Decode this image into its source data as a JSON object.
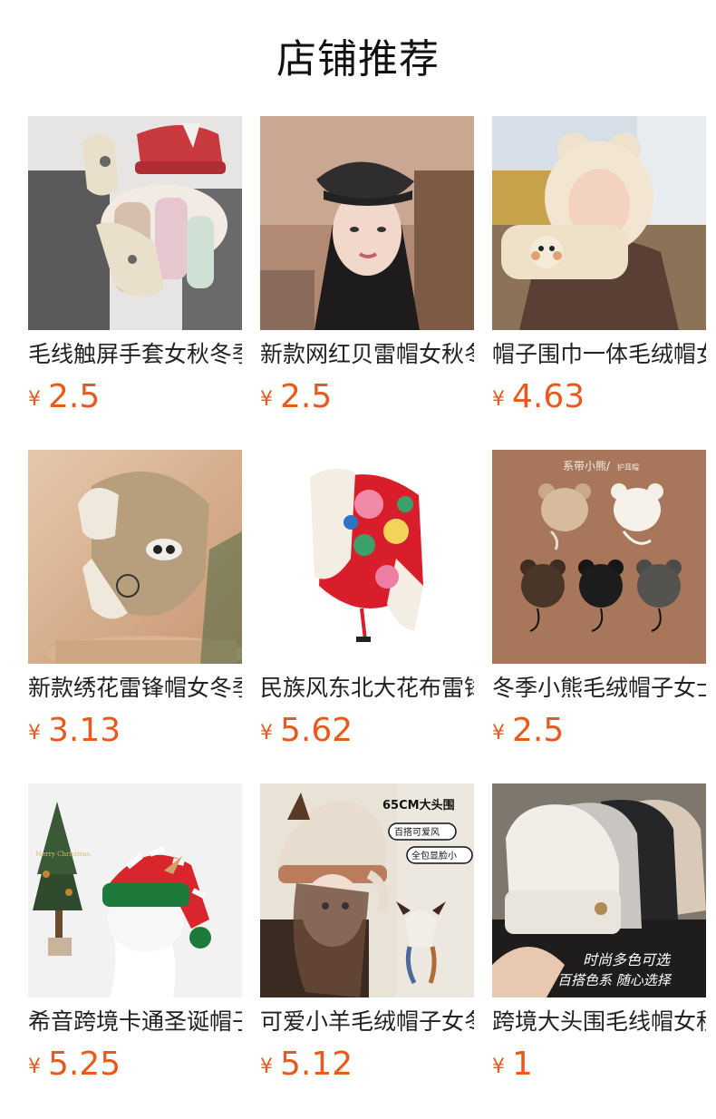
{
  "header": {
    "title": "店铺推荐"
  },
  "currency_symbol": "¥",
  "products": [
    {
      "name": "毛线触屏手套女秋冬季",
      "price": "2.5",
      "image_icon": "gloves-photo"
    },
    {
      "name": "新款网红贝雷帽女秋冬",
      "price": "2.5",
      "image_icon": "beret-photo"
    },
    {
      "name": "帽子围巾一体毛绒帽女",
      "price": "4.63",
      "image_icon": "hat-scarf-photo"
    },
    {
      "name": "新款绣花雷锋帽女冬季",
      "price": "3.13",
      "image_icon": "trapper-hat-photo"
    },
    {
      "name": "民族风东北大花布雷锋帽",
      "price": "5.62",
      "image_icon": "floral-trapper-hat-photo"
    },
    {
      "name": "冬季小熊毛绒帽子女士",
      "price": "2.5",
      "image_icon": "bear-ear-hats-photo"
    },
    {
      "name": "希音跨境卡通圣诞帽子",
      "price": "5.25",
      "image_icon": "christmas-hat-photo"
    },
    {
      "name": "可爱小羊毛绒帽子女冬",
      "price": "5.12",
      "image_icon": "sheep-hat-photo"
    },
    {
      "name": "跨境大头围毛线帽女秋",
      "price": "1",
      "image_icon": "knit-beanie-photo"
    }
  ],
  "overlay_text": {
    "bear": {
      "title": "系带小熊/",
      "subtitle": "护耳帽"
    },
    "sheep": {
      "size": "65CM大头围",
      "tag1": "百搭可爱风",
      "tag2": "全包显脸小"
    },
    "beanie": {
      "line1": "时尚多色可选",
      "line2": "百搭色系 随心选择"
    },
    "xmas": {
      "sign": "Merry Christmas"
    }
  },
  "colors": {
    "price": "#e85a1c",
    "title": "#111111",
    "text": "#222222"
  }
}
